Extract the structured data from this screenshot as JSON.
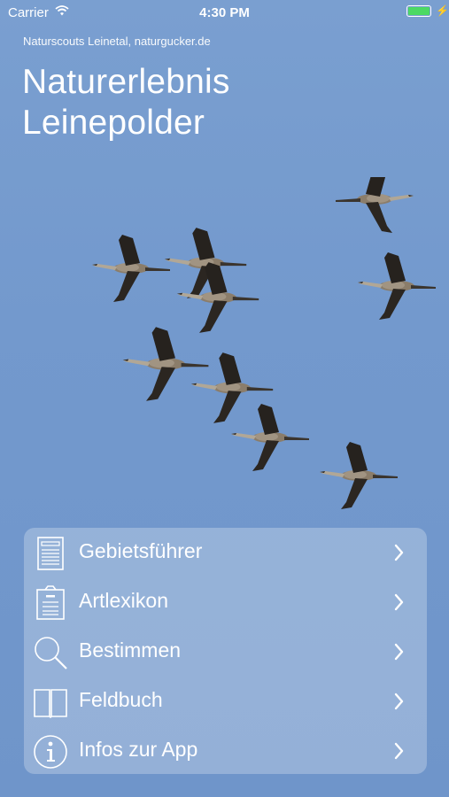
{
  "status_bar": {
    "carrier": "Carrier",
    "time": "4:30 PM",
    "battery_level": 1.0,
    "battery_color": "#4cd964"
  },
  "credit": "Naturscouts Leinetal, naturgucker.de",
  "title": {
    "line1": "Naturerlebnis",
    "line2": "Leinepolder"
  },
  "background_image": "flock-of-cranes",
  "menu": {
    "items": [
      {
        "label": "Gebietsführer",
        "icon": "document-icon"
      },
      {
        "label": "Artlexikon",
        "icon": "clipboard-icon"
      },
      {
        "label": "Bestimmen",
        "icon": "magnifier-icon"
      },
      {
        "label": "Feldbuch",
        "icon": "book-icon"
      },
      {
        "label": "Infos zur App",
        "icon": "info-icon"
      }
    ]
  },
  "colors": {
    "sky": "#7399cd",
    "menu_background": "rgba(255,255,255,0.26)",
    "text": "#ffffff"
  }
}
